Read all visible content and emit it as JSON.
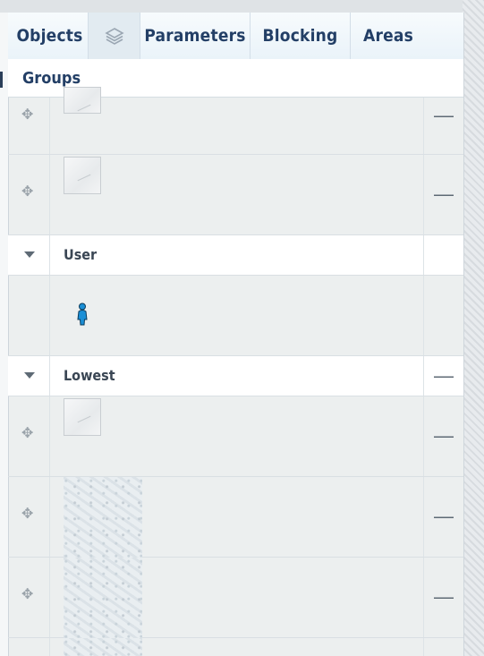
{
  "tabs": [
    {
      "label": "Objects"
    },
    {
      "icon": "layers-icon"
    },
    {
      "label": "Parameters"
    },
    {
      "label": "Blocking"
    },
    {
      "label": "Areas"
    }
  ],
  "groups_header": "Groups",
  "groups": [
    {
      "label": "User"
    },
    {
      "label": "Lowest"
    }
  ],
  "remove_symbol": "—",
  "colors": {
    "tab_text": "#233f66",
    "user_icon": "#1b8fd6"
  }
}
